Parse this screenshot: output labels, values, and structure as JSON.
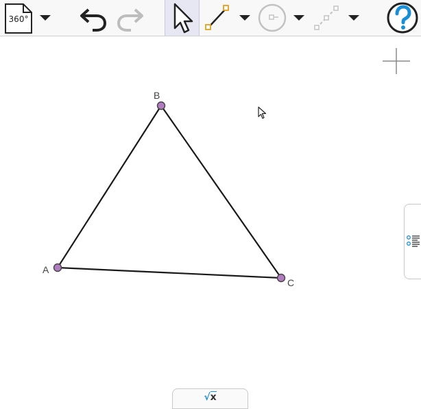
{
  "toolbar": {
    "file_label": "360°",
    "tools": [
      "undo",
      "redo",
      "select",
      "segment",
      "circle",
      "perpendicular"
    ]
  },
  "graphics": {
    "points": [
      {
        "label": "A"
      },
      {
        "label": "B"
      },
      {
        "label": "C"
      }
    ],
    "colors": {
      "point_fill": "#b07bbf",
      "point_stroke": "#444444",
      "segment": "#1a1a1a",
      "accent_blue": "#1a8fd6"
    }
  },
  "input_bar": {
    "sqrt_glyph": "√",
    "x_glyph": "x"
  }
}
